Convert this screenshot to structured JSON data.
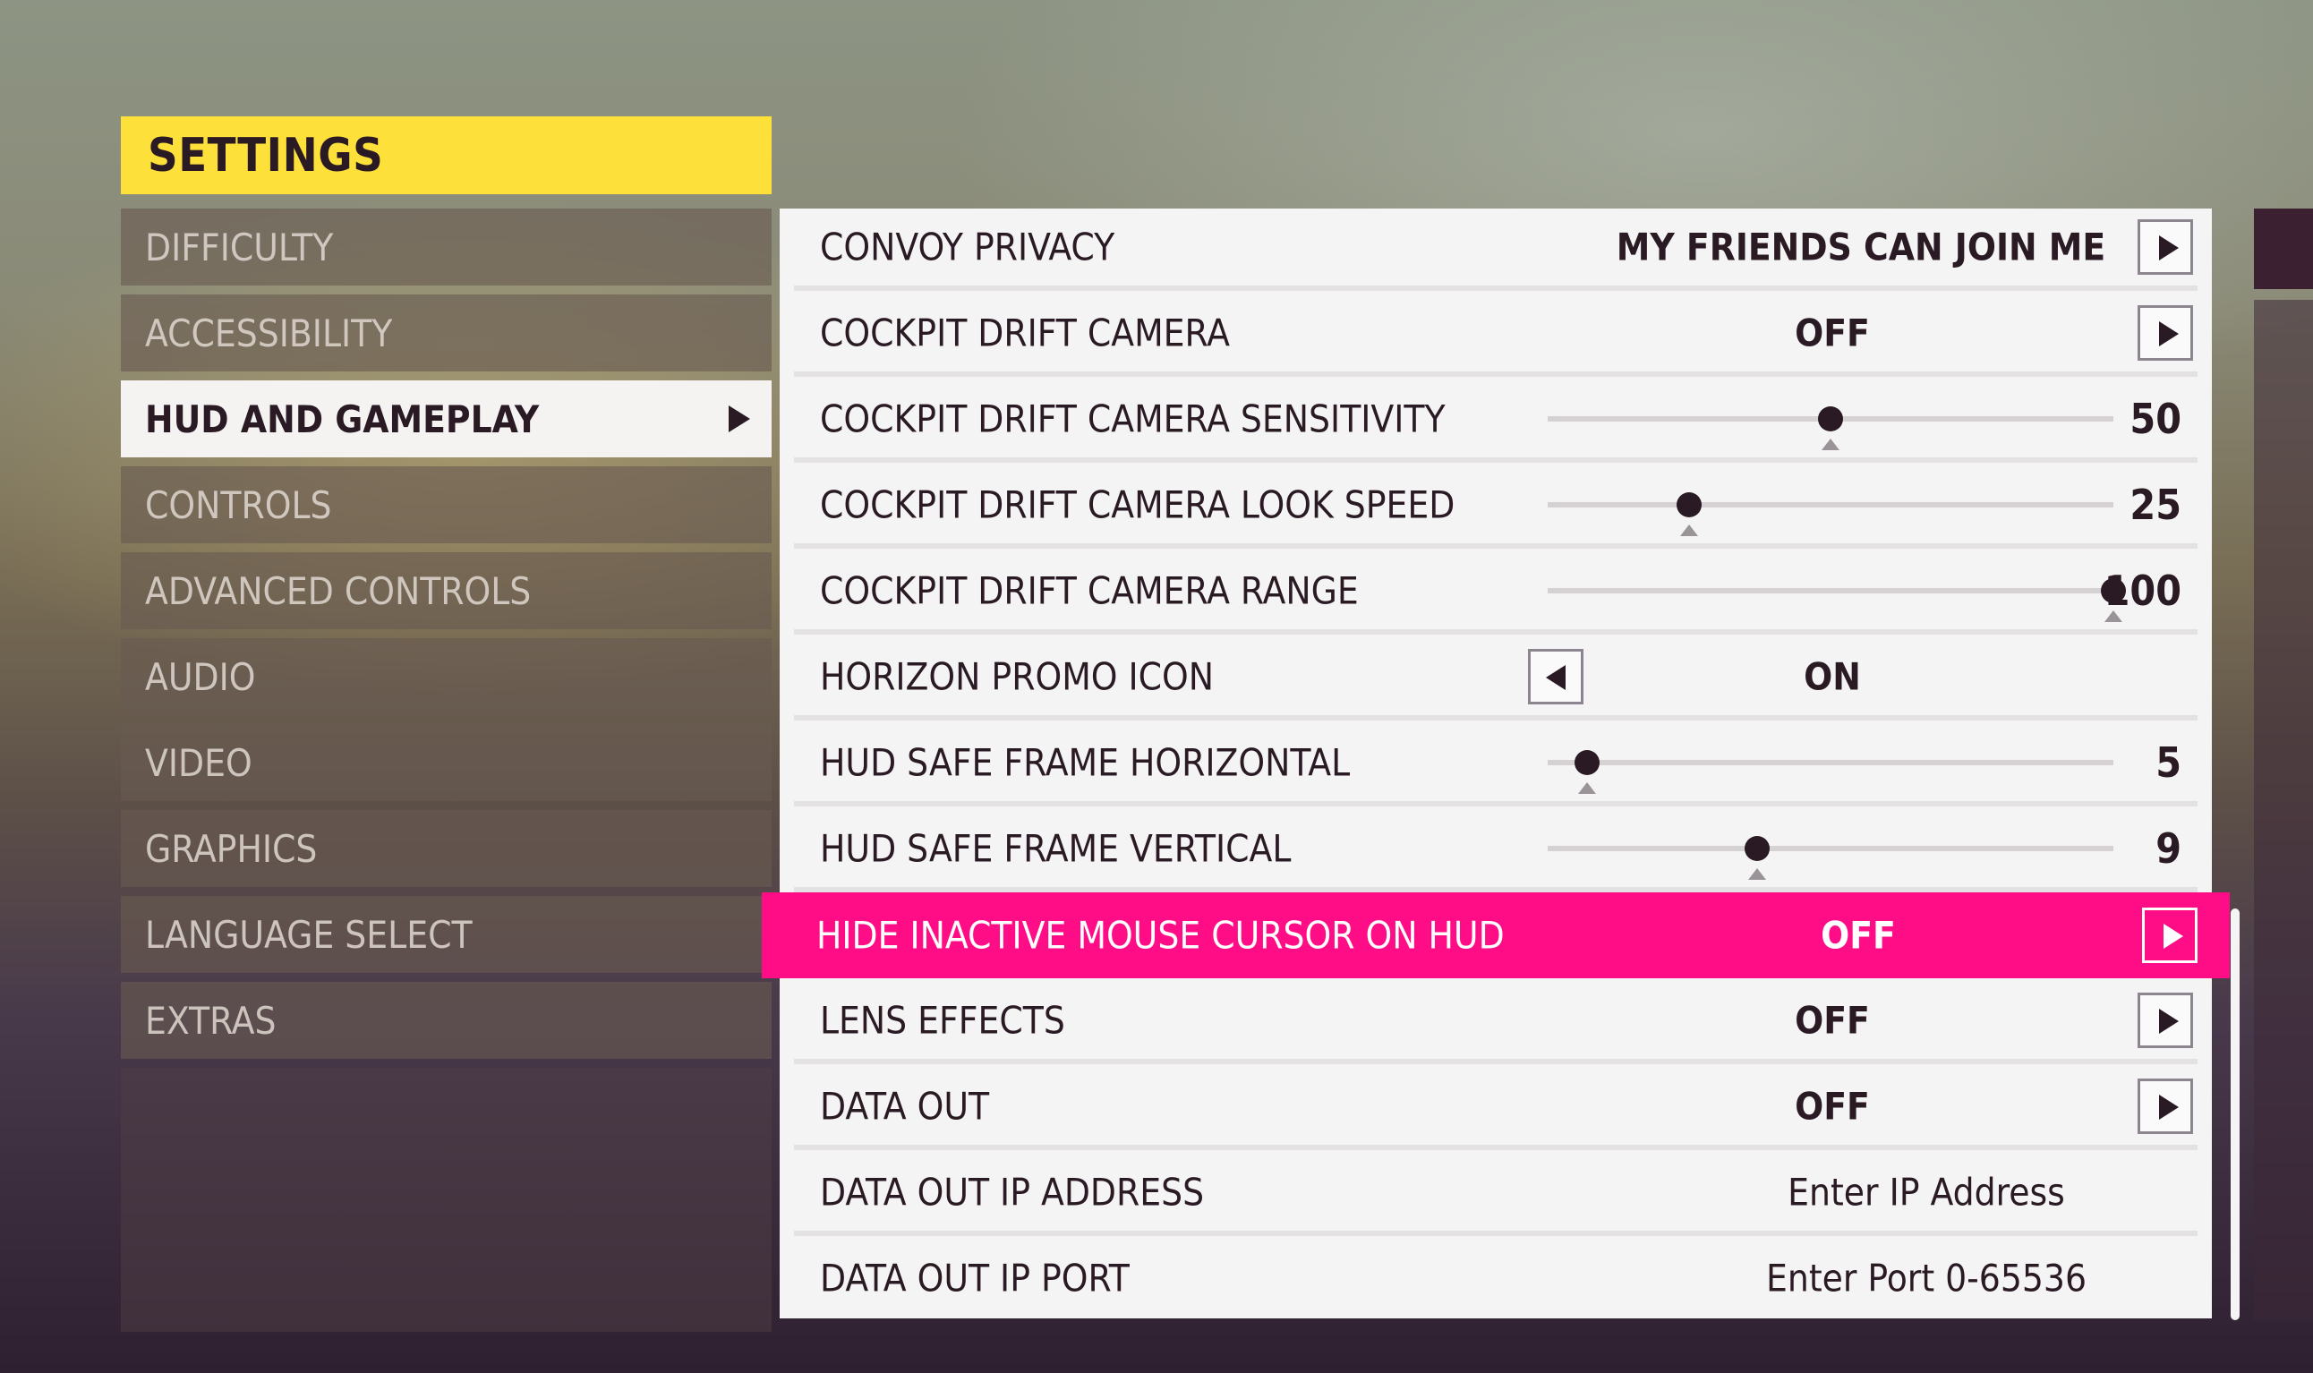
{
  "title": "SETTINGS",
  "sidebar": {
    "items": [
      {
        "label": "DIFFICULTY"
      },
      {
        "label": "ACCESSIBILITY"
      },
      {
        "label": "HUD AND GAMEPLAY",
        "active": true
      },
      {
        "label": "CONTROLS"
      },
      {
        "label": "ADVANCED CONTROLS"
      },
      {
        "label": "AUDIO"
      },
      {
        "label": "VIDEO"
      },
      {
        "label": "GRAPHICS"
      },
      {
        "label": "LANGUAGE SELECT"
      },
      {
        "label": "EXTRAS"
      }
    ]
  },
  "settings": {
    "convoy_privacy": {
      "label": "CONVOY PRIVACY",
      "value": "MY FRIENDS CAN JOIN ME"
    },
    "cockpit_drift_camera": {
      "label": "COCKPIT DRIFT CAMERA",
      "value": "OFF"
    },
    "cockpit_drift_camera_sensitivity": {
      "label": "COCKPIT DRIFT CAMERA SENSITIVITY",
      "value": "50",
      "level": 0.5
    },
    "cockpit_drift_camera_look_speed": {
      "label": "COCKPIT DRIFT CAMERA LOOK SPEED",
      "value": "25",
      "level": 0.25
    },
    "cockpit_drift_camera_range": {
      "label": "COCKPIT DRIFT CAMERA RANGE",
      "value": "100",
      "level": 1.0
    },
    "horizon_promo_icon": {
      "label": "HORIZON PROMO ICON",
      "value": "ON"
    },
    "hud_safe_frame_horizontal": {
      "label": "HUD SAFE FRAME HORIZONTAL",
      "value": "5",
      "level": 0.07
    },
    "hud_safe_frame_vertical": {
      "label": "HUD SAFE FRAME VERTICAL",
      "value": "9",
      "level": 0.37
    },
    "hide_inactive_mouse_cursor": {
      "label": "HIDE INACTIVE MOUSE CURSOR ON HUD",
      "value": "OFF"
    },
    "lens_effects": {
      "label": "LENS EFFECTS",
      "value": "OFF"
    },
    "data_out": {
      "label": "DATA OUT",
      "value": "OFF"
    },
    "data_out_ip_address": {
      "label": "DATA OUT IP ADDRESS",
      "placeholder": "Enter IP Address"
    },
    "data_out_ip_port": {
      "label": "DATA OUT IP PORT",
      "placeholder": "Enter Port 0-65536"
    }
  },
  "colors": {
    "title_bar": "#fde03a",
    "highlight": "#ff0d87",
    "text_dark": "#2a1a24"
  },
  "icons": {
    "next": "triangle-right-icon",
    "prev": "triangle-left-icon",
    "slider_knob": "circle-knob-icon"
  }
}
